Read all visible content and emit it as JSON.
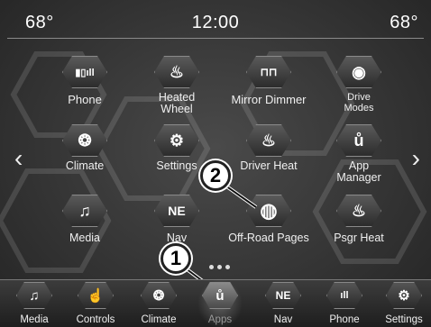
{
  "status": {
    "temp_left": "68°",
    "clock": "12:00",
    "temp_right": "68°"
  },
  "apps": [
    {
      "label": "Phone",
      "icon": "phone-signal-icon",
      "glyph": "▮▯ıll"
    },
    {
      "label": "Heated Wheel",
      "icon": "heated-wheel-icon",
      "glyph": "♨"
    },
    {
      "label": "Mirror Dimmer",
      "icon": "mirror-dimmer-icon",
      "glyph": "⊓⊓"
    },
    {
      "label": "Drive Modes",
      "icon": "drive-modes-icon",
      "glyph": "◉"
    },
    {
      "label": "Climate",
      "icon": "climate-icon",
      "glyph": "❂"
    },
    {
      "label": "Settings",
      "icon": "settings-gear-icon",
      "glyph": "⚙"
    },
    {
      "label": "Driver Heat",
      "icon": "driver-seat-heat-icon",
      "glyph": "♨"
    },
    {
      "label": "App Manager",
      "icon": "app-manager-icon",
      "glyph": "ů"
    },
    {
      "label": "Media",
      "icon": "music-note-icon",
      "glyph": "♫"
    },
    {
      "label": "Nav",
      "icon": "nav-compass-icon",
      "glyph": "NE"
    },
    {
      "label": "Off-Road Pages",
      "icon": "off-road-tire-icon",
      "glyph": "◍"
    },
    {
      "label": "Psgr Heat",
      "icon": "passenger-seat-heat-icon",
      "glyph": "♨"
    }
  ],
  "callouts": [
    "1",
    "2"
  ],
  "dock": [
    {
      "label": "Media",
      "icon": "music-note-icon",
      "glyph": "♫"
    },
    {
      "label": "Controls",
      "icon": "controls-hand-icon",
      "glyph": "☝"
    },
    {
      "label": "Climate",
      "icon": "climate-icon",
      "glyph": "❂"
    },
    {
      "label": "Apps",
      "icon": "apps-u-icon",
      "glyph": "ů",
      "active": true
    },
    {
      "label": "Nav",
      "icon": "nav-compass-icon",
      "glyph": "NE"
    },
    {
      "label": "Phone",
      "icon": "phone-signal-icon",
      "glyph": "ıll"
    },
    {
      "label": "Settings",
      "icon": "settings-gear-icon",
      "glyph": "⚙"
    }
  ]
}
